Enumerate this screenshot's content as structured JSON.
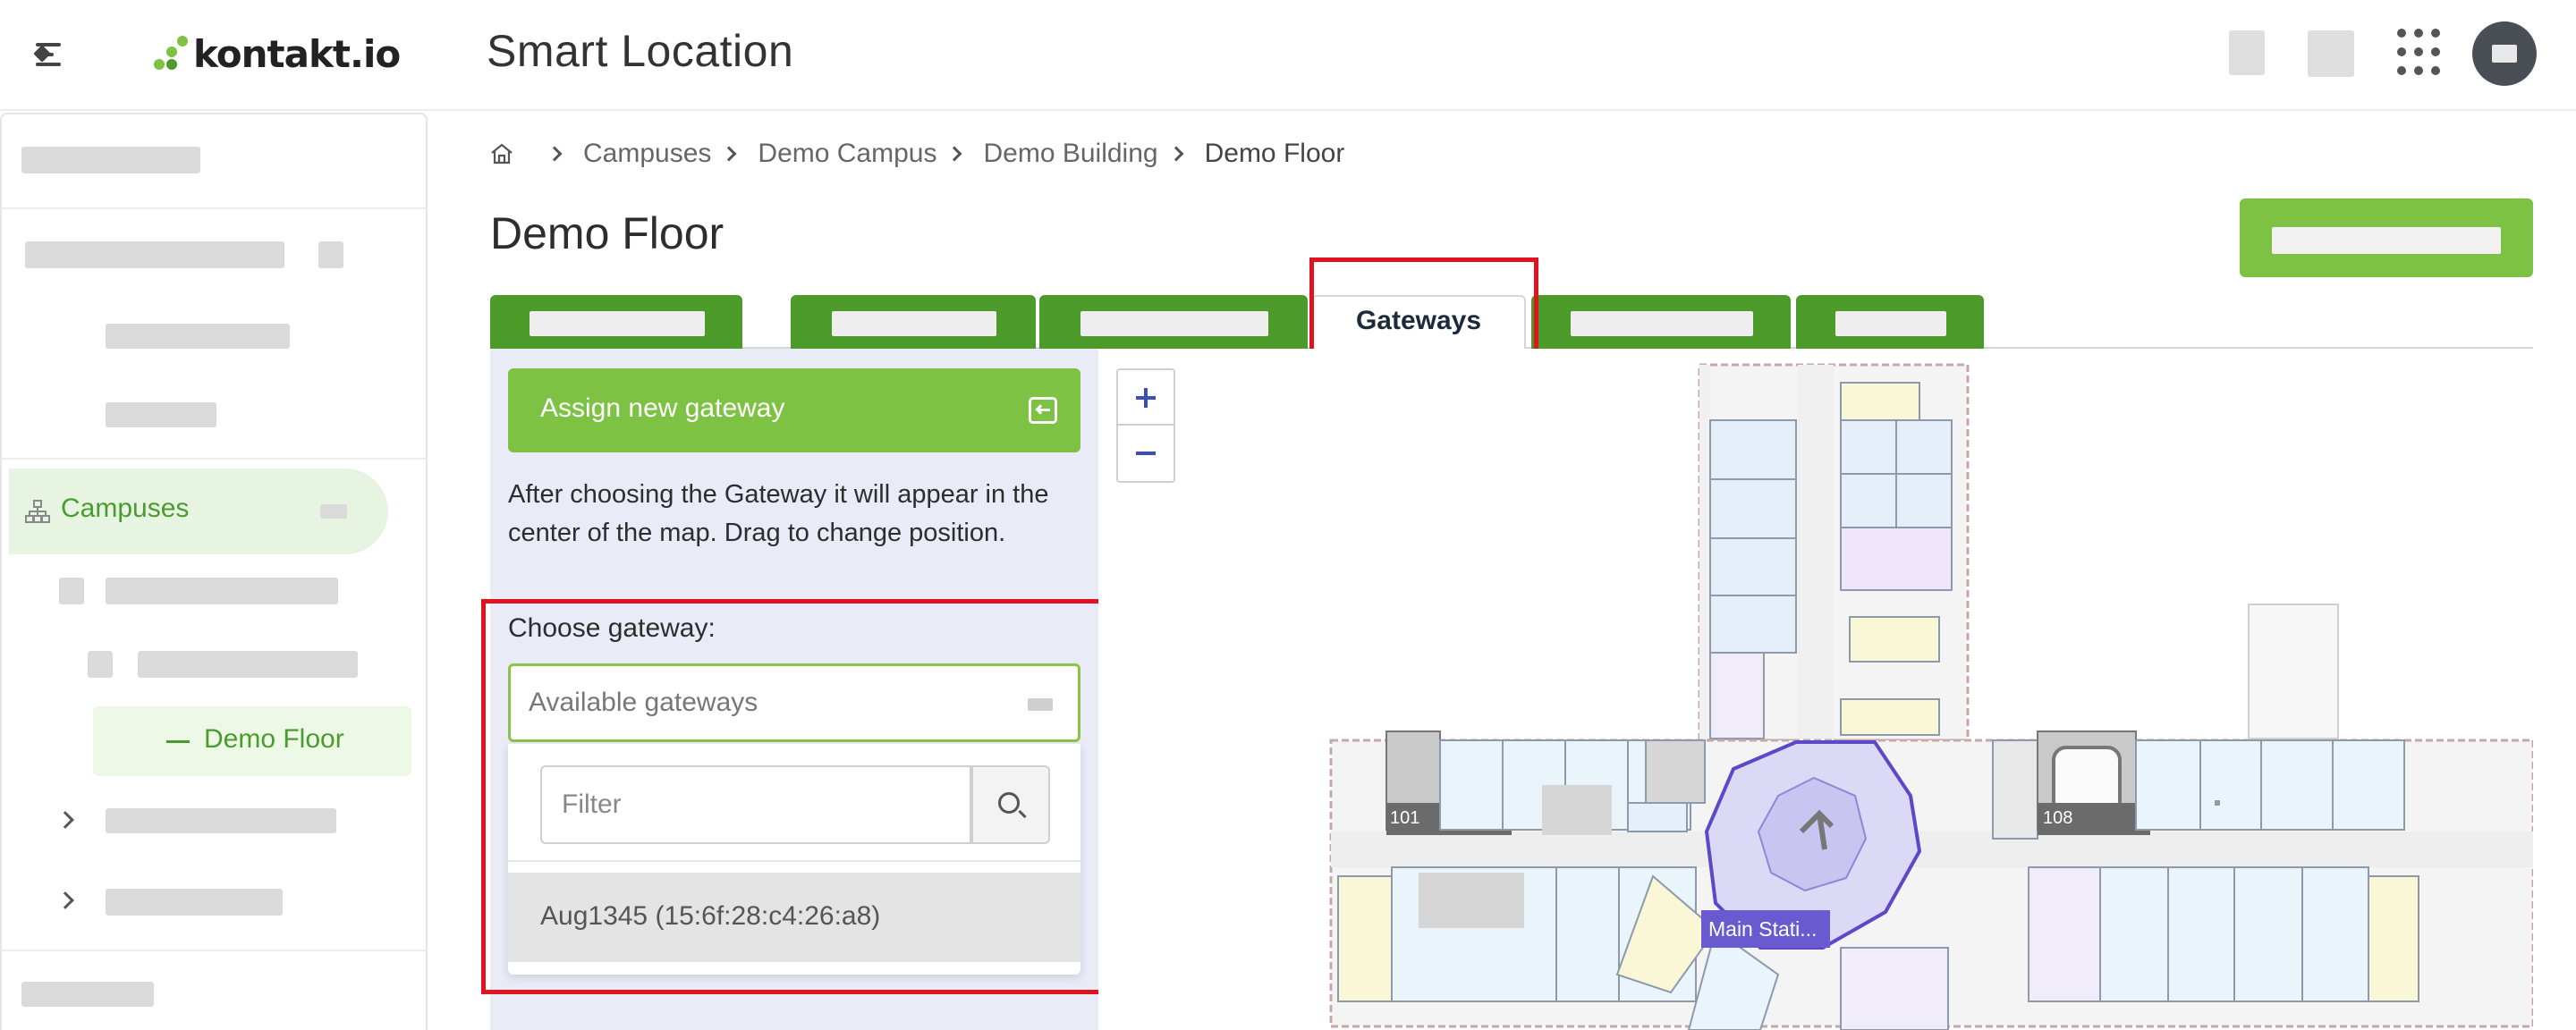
{
  "header": {
    "logo_text": "kontakt.io",
    "app_title": "Smart Location"
  },
  "sidebar": {
    "active_item": "Campuses",
    "current_floor": "Demo Floor"
  },
  "breadcrumb": {
    "items": [
      "Campuses",
      "Demo Campus",
      "Demo Building"
    ],
    "current": "Demo Floor"
  },
  "page": {
    "title": "Demo Floor"
  },
  "tabs": {
    "active_label": "Gateways"
  },
  "panel": {
    "assign_button": "Assign new gateway",
    "help_text": "After choosing the Gateway it will appear in the center of the map. Drag to change position.",
    "choose_label": "Choose gateway:",
    "select_placeholder": "Available gateways",
    "filter_placeholder": "Filter",
    "options": [
      "Aug1345 (15:6f:28:c4:26:a8)"
    ]
  },
  "map": {
    "zoom_in": "+",
    "zoom_out": "−",
    "station_label": "Main Stati...",
    "room_labels": [
      "101",
      "108"
    ]
  },
  "colors": {
    "brand_green": "#7dc243",
    "tab_green": "#4c9a2a",
    "highlight_red": "#e0141e",
    "station_purple": "#6a5ad0"
  }
}
